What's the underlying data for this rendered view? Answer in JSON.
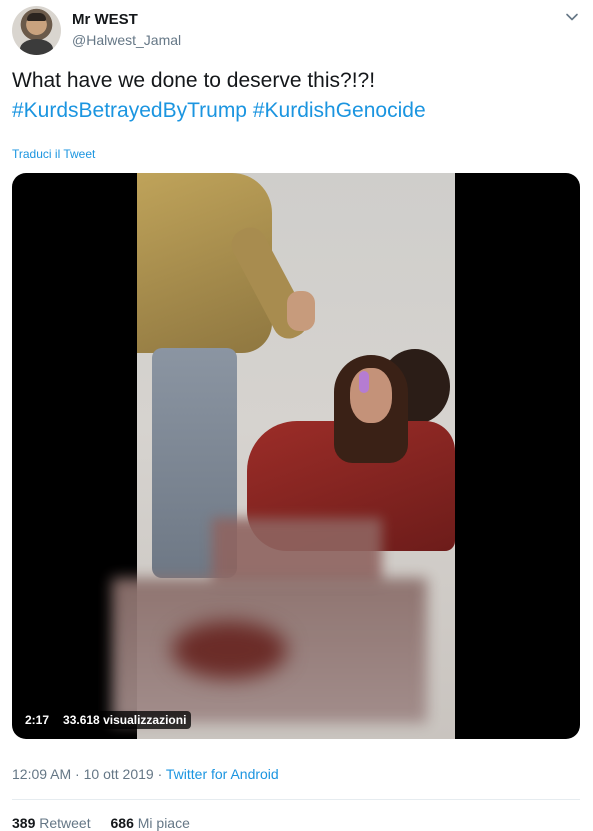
{
  "user": {
    "display_name": "Mr WEST",
    "handle": "@Halwest_Jamal"
  },
  "tweet": {
    "text": "What have we done to deserve this?!?!",
    "hashtags": [
      "#KurdsBetrayedByTrump",
      "#KurdishGenocide"
    ],
    "translate_label": "Traduci il Tweet"
  },
  "video": {
    "duration": "2:17",
    "views": "33.618 visualizzazioni"
  },
  "meta": {
    "time": "12:09 AM",
    "separator": "·",
    "date": "10 ott 2019",
    "source": "Twitter for Android"
  },
  "stats": {
    "retweets_count": "389",
    "retweets_label": "Retweet",
    "likes_count": "686",
    "likes_label": "Mi piace"
  },
  "colors": {
    "link": "#1b95e0",
    "muted": "#657786",
    "text": "#14171a"
  },
  "icons": {
    "caret": "chevron-down-icon"
  }
}
